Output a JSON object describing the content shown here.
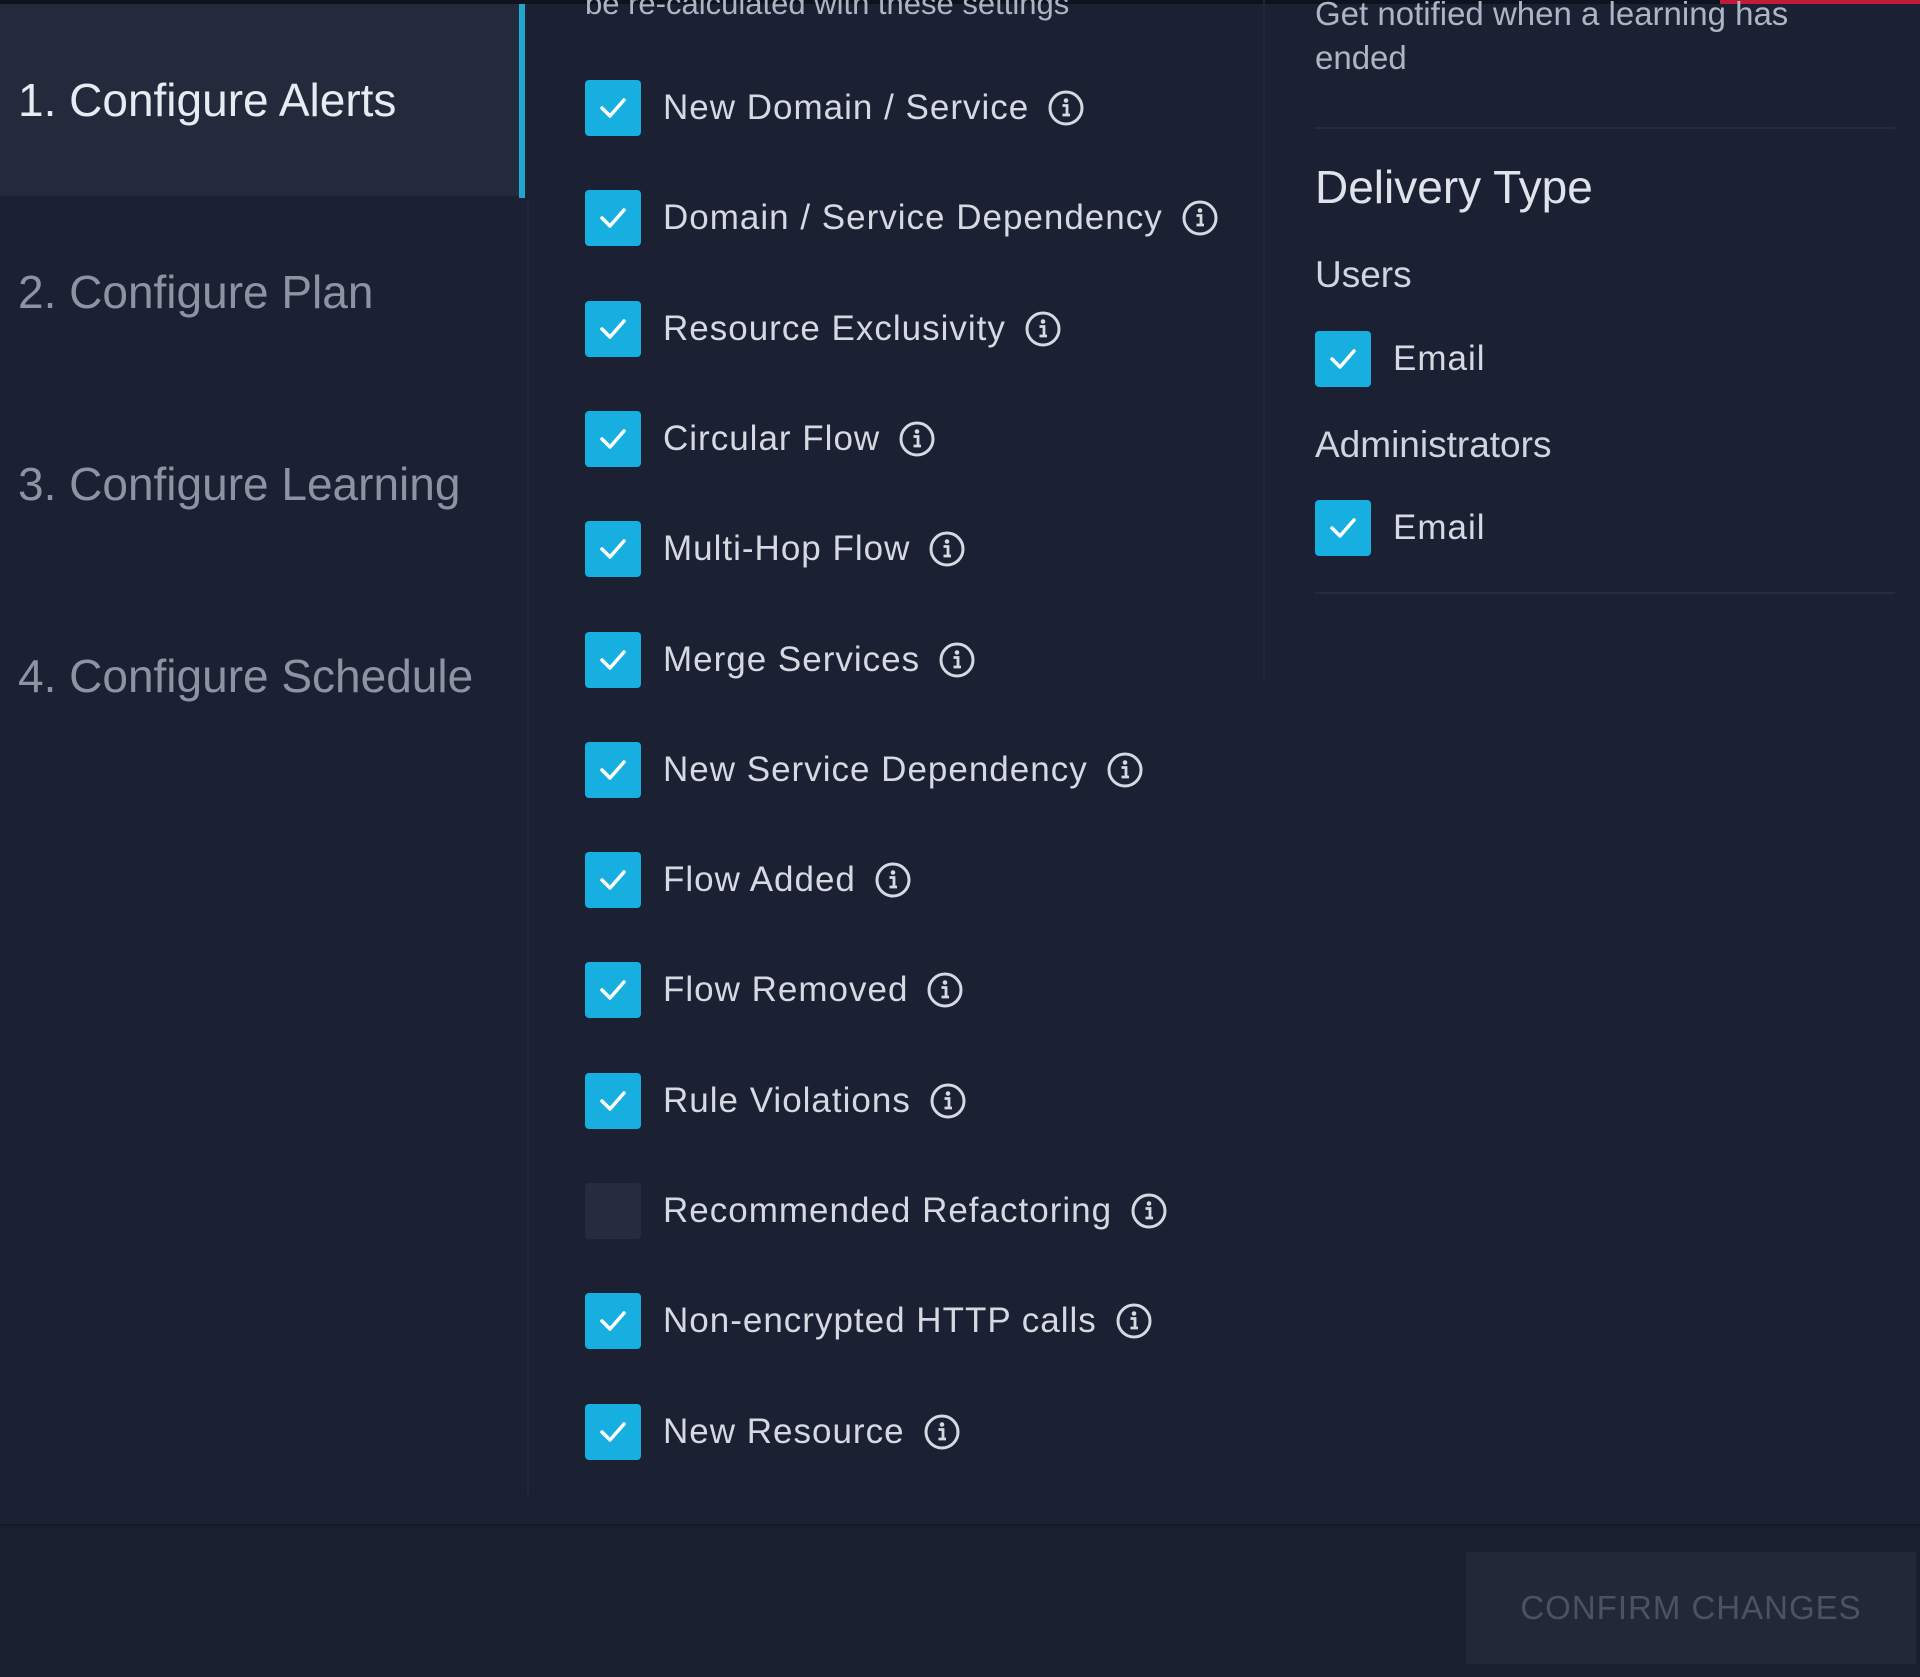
{
  "sidebar": {
    "steps": [
      {
        "label": "1. Configure Alerts",
        "active": true
      },
      {
        "label": "2. Configure Plan",
        "active": false
      },
      {
        "label": "3. Configure Learning",
        "active": false
      },
      {
        "label": "4. Configure Schedule",
        "active": false
      }
    ]
  },
  "alerts": {
    "intro_text": "be re-calculated with these settings",
    "items": [
      {
        "label": "New Domain / Service",
        "checked": true
      },
      {
        "label": "Domain / Service Dependency",
        "checked": true
      },
      {
        "label": "Resource Exclusivity",
        "checked": true
      },
      {
        "label": "Circular Flow",
        "checked": true
      },
      {
        "label": "Multi-Hop Flow",
        "checked": true
      },
      {
        "label": "Merge Services",
        "checked": true
      },
      {
        "label": "New Service Dependency",
        "checked": true
      },
      {
        "label": "Flow Added",
        "checked": true
      },
      {
        "label": "Flow Removed",
        "checked": true
      },
      {
        "label": "Rule Violations",
        "checked": true
      },
      {
        "label": "Recommended Refactoring",
        "checked": false
      },
      {
        "label": "Non-encrypted HTTP calls",
        "checked": true
      },
      {
        "label": "New Resource",
        "checked": true
      }
    ]
  },
  "notifications": {
    "learning_text": "Get notified when a learning has ended",
    "delivery_title": "Delivery Type",
    "groups": [
      {
        "label": "Users",
        "email_label": "Email",
        "email_checked": true
      },
      {
        "label": "Administrators",
        "email_label": "Email",
        "email_checked": true
      }
    ]
  },
  "footer": {
    "confirm_label": "CONFIRM CHANGES"
  },
  "colors": {
    "accent": "#17aee0",
    "background": "#1b2133",
    "checkbox_off": "#252c3e"
  },
  "icons": {
    "check": "checkmark-icon",
    "info": "info-icon"
  }
}
